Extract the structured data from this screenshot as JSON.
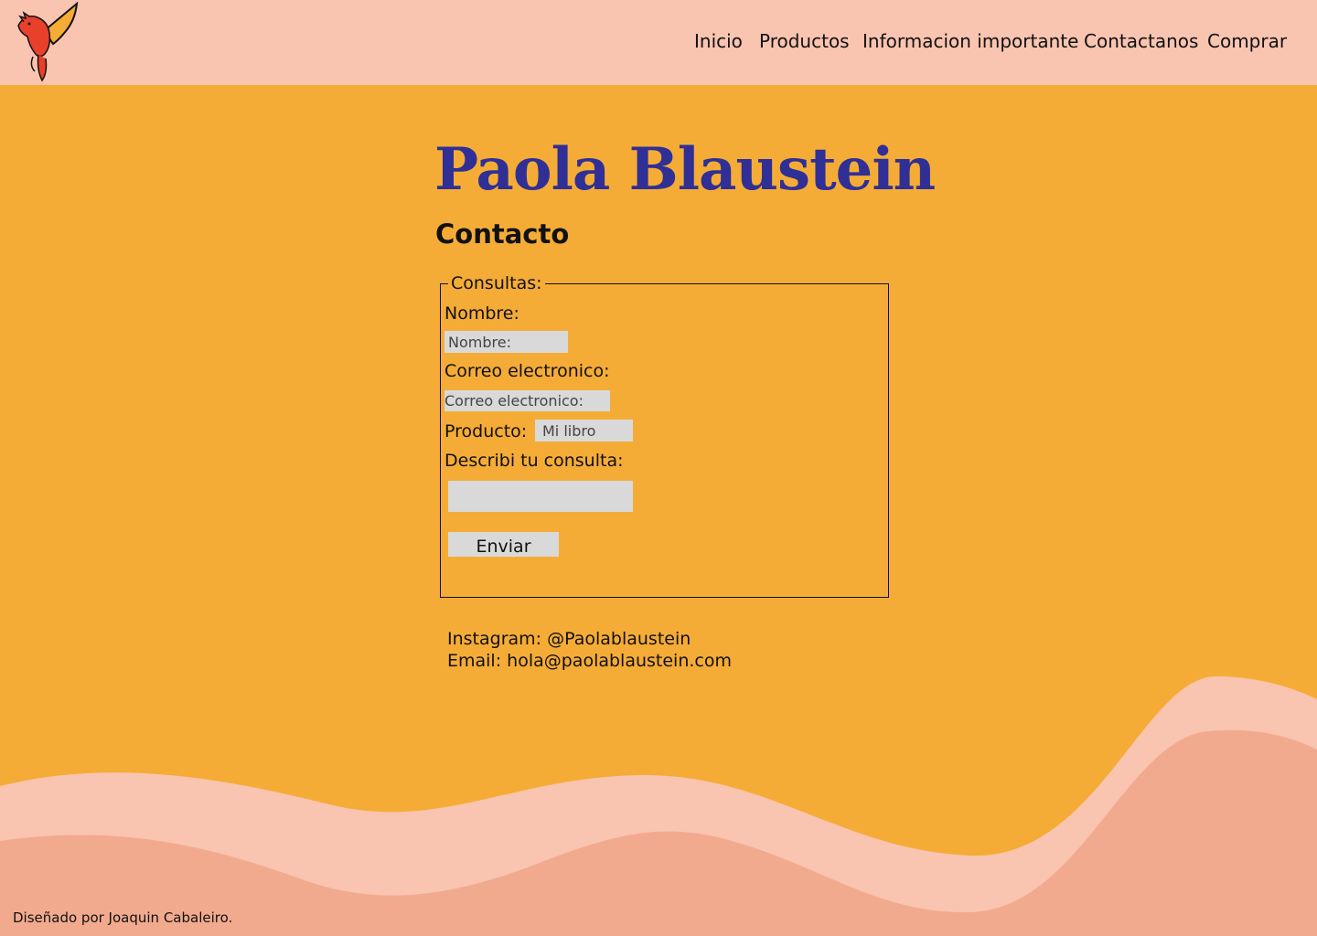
{
  "nav": {
    "items": [
      {
        "label": "Inicio"
      },
      {
        "label": "Productos"
      },
      {
        "label": "Informacion importante"
      },
      {
        "label": "Contactanos"
      },
      {
        "label": "Comprar"
      }
    ]
  },
  "site_title": "Paola Blaustein",
  "section_title": "Contacto",
  "form": {
    "legend": "Consultas:",
    "name_label": "Nombre:",
    "name_placeholder": "Nombre:",
    "email_label": "Correo electronico:",
    "email_placeholder": "Correo electronico:",
    "product_label": "Producto:",
    "product_placeholder": "Mi libro",
    "message_label": "Describi tu consulta:",
    "submit_label": "Enviar"
  },
  "contact": {
    "instagram": "Instagram: @Paolablaustein",
    "email": "Email: hola@paolablaustein.com"
  },
  "footer": "Diseñado por Joaquin Cabaleiro.",
  "colors": {
    "header_bg": "#f9c4b0",
    "page_bg": "#f5ac36",
    "title": "#2f2f96",
    "wave_light": "#f9c4b0",
    "wave_dark": "#f2aa8e",
    "input_bg": "#d9d9d9"
  }
}
